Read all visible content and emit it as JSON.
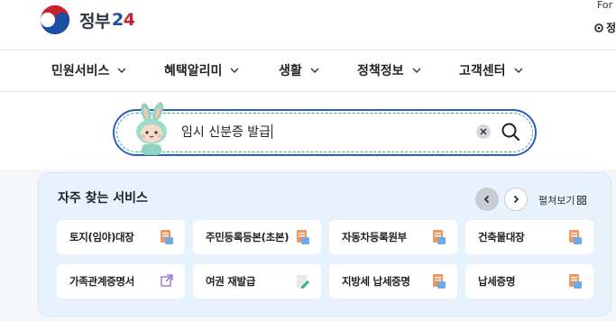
{
  "header": {
    "logo_text_main": "정부",
    "logo_text_2": "2",
    "logo_text_4": "4",
    "util_top": "For",
    "util_bottom": "정"
  },
  "nav": {
    "items": [
      {
        "label": "민원서비스"
      },
      {
        "label": "혜택알리미"
      },
      {
        "label": "생활"
      },
      {
        "label": "정책정보"
      },
      {
        "label": "고객센터"
      }
    ]
  },
  "search": {
    "value": "임시 신분증 발급",
    "icon": "search-icon",
    "clear_icon": "close-icon"
  },
  "panel": {
    "title": "자주 찾는 서비스",
    "expand_label": "펼쳐보기",
    "cards": [
      {
        "label": "토지(임야)대장",
        "icon": "document-icon"
      },
      {
        "label": "주민등록등본(초본)",
        "icon": "document-icon"
      },
      {
        "label": "자동차등록원부",
        "icon": "document-icon"
      },
      {
        "label": "건축물대장",
        "icon": "document-icon"
      },
      {
        "label": "가족관계증명서",
        "icon": "external-link-icon"
      },
      {
        "label": "여권 재발급",
        "icon": "edit-document-icon"
      },
      {
        "label": "지방세 납세증명",
        "icon": "document-icon"
      },
      {
        "label": "납세증명",
        "icon": "document-icon"
      }
    ]
  },
  "colors": {
    "brand_blue": "#1b4fa3",
    "brand_red": "#c8202f",
    "search_border": "#2c5fc4",
    "panel_bg": "#e8f2fd"
  }
}
